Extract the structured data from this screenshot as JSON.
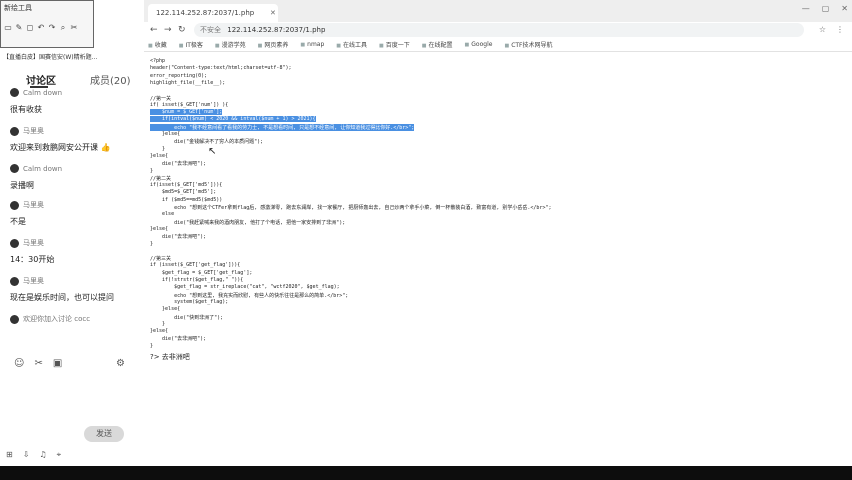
{
  "toolbox": {
    "title": "新绘工具",
    "icons": [
      "▭",
      "✎",
      "◻",
      "↶",
      "↷",
      "⌕",
      "✂"
    ]
  },
  "chat": {
    "banner": "【直播白皮】国赛信安(W)精析题...",
    "tab_discuss": "讨论区",
    "tab_members": "成员(20)",
    "messages": [
      {
        "user": "Calm down",
        "text": "很有收获"
      },
      {
        "user": "马里奥",
        "text": "欢迎来到救鹏网安公开课 👍"
      },
      {
        "user": "Calm down",
        "text": "录播啊"
      },
      {
        "user": "马里奥",
        "text": "不是"
      },
      {
        "user": "马里奥",
        "text": "14：30开始"
      },
      {
        "user": "马里奥",
        "text": "现在是娱乐时间，也可以提问"
      },
      {
        "user": "欢迎你加入讨论 cocc",
        "text": ""
      }
    ],
    "send_label": "发送",
    "bottom_icons": [
      "☺",
      "✂",
      "▣"
    ],
    "footer_icons": [
      "⊞",
      "⇩",
      "♫",
      "⌖"
    ]
  },
  "browser": {
    "tab_title": "122.114.252.87:2037/1.php",
    "url": "122.114.252.87:2037/1.php",
    "insecure_label": "不安全",
    "nav": [
      "←",
      "→",
      "↻"
    ],
    "bookmarks": [
      "收藏",
      "IT极客",
      "漫游学苑",
      "网页素养",
      "nmap",
      "在线工具",
      "百度一下",
      "在线配置",
      "Google",
      "CTF技术网导航"
    ],
    "source_lines": [
      {
        "t": "<?php",
        "hl": false
      },
      {
        "t": "header(\"Content-type:text/html;charset=utf-8\");",
        "hl": false
      },
      {
        "t": "error_reporting(0);",
        "hl": false
      },
      {
        "t": "highlight_file(__file__);",
        "hl": false
      },
      {
        "t": "",
        "hl": false
      },
      {
        "t": "//第一关",
        "hl": false
      },
      {
        "t": "if( isset($_GET['num']) ){",
        "hl": false
      },
      {
        "t": "    $num = $_GET['num'];",
        "hl": true
      },
      {
        "t": "    if(intval($num) < 2020 && intval($num + 1) > 2021){",
        "hl": true
      },
      {
        "t": "        echo \"我不经意间看了看我的劳力士, 不是想看时间, 只是想不经意间, 让你知道我过得比你好.</br>\";",
        "hl": true
      },
      {
        "t": "    }else{",
        "hl": false
      },
      {
        "t": "        die(\"金钱解决不了穷人的本质问题\");",
        "hl": false
      },
      {
        "t": "    }",
        "hl": false
      },
      {
        "t": "}else{",
        "hl": false
      },
      {
        "t": "    die(\"去非洲吧\");",
        "hl": false
      },
      {
        "t": "}",
        "hl": false
      },
      {
        "t": "//第二关",
        "hl": false
      },
      {
        "t": "if(isset($_GET['md5'])){",
        "hl": false
      },
      {
        "t": "    $md5=$_GET['md5'];",
        "hl": false
      },
      {
        "t": "    if ($md5==md5($md5))",
        "hl": false
      },
      {
        "t": "        echo \"想到这个CTFer拿到flag后, 感激涕零, 跑去东澜岸, 找一家餐厅, 把厨师轰出去, 自己炒两个拿手小菜, 倒一杯散装白酒, 致富有道, 别学小岳岳.</br>\";",
        "hl": false
      },
      {
        "t": "    else",
        "hl": false
      },
      {
        "t": "        die(\"我赶紧喊来我的酒肉朋友, 他打了个电话, 把他一家安排到了非洲\");",
        "hl": false
      },
      {
        "t": "}else{",
        "hl": false
      },
      {
        "t": "    die(\"去非洲吧\");",
        "hl": false
      },
      {
        "t": "}",
        "hl": false
      },
      {
        "t": "",
        "hl": false
      },
      {
        "t": "//第三关",
        "hl": false
      },
      {
        "t": "if (isset($_GET['get_flag'])){",
        "hl": false
      },
      {
        "t": "    $get_flag = $_GET['get_flag'];",
        "hl": false
      },
      {
        "t": "    if(!strstr($get_flag,\" \")){",
        "hl": false
      },
      {
        "t": "        $get_flag = str_ireplace(\"cat\", \"wctf2020\", $get_flag);",
        "hl": false
      },
      {
        "t": "        echo \"想到这里, 我充实而欣慰, 有些人的快乐往往是那么的简单.</br>\";",
        "hl": false
      },
      {
        "t": "        system($get_flag);",
        "hl": false
      },
      {
        "t": "    }else{",
        "hl": false
      },
      {
        "t": "        die(\"快到非洲了\");",
        "hl": false
      },
      {
        "t": "    }",
        "hl": false
      },
      {
        "t": "}else{",
        "hl": false
      },
      {
        "t": "    die(\"去非洲吧\");",
        "hl": false
      },
      {
        "t": "}",
        "hl": false
      }
    ],
    "output": "?> 去非洲吧"
  }
}
